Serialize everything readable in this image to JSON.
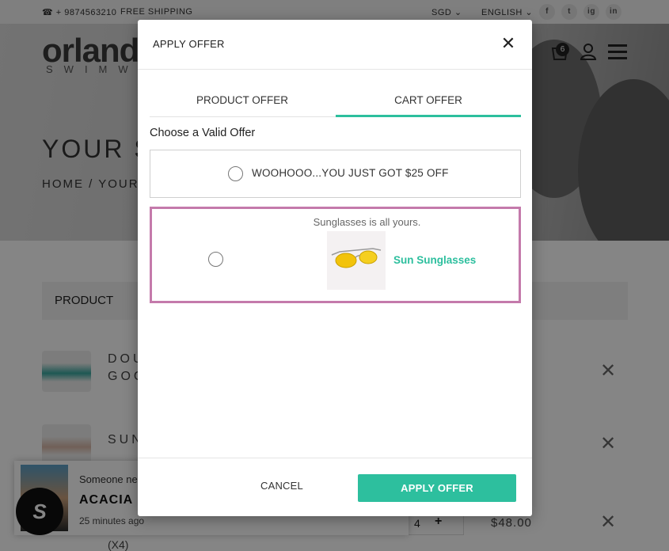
{
  "topbar": {
    "phone": "☎ + 9874563210",
    "shipping": "FREE SHIPPING",
    "currency": "SGD ⌄",
    "language": "ENGLISH ⌄",
    "social": [
      "f",
      "t",
      "ig",
      "in"
    ]
  },
  "header": {
    "logo": "orland",
    "logo_sub": "SWIMWEA",
    "cart_count": "6"
  },
  "hero": {
    "title": "YOUR SH",
    "breadcrumb": "HOME / YOUR SH"
  },
  "cart_table": {
    "header_product": "PRODUCT",
    "rows": [
      {
        "name_line1": "DOU",
        "name_line2": "GOG"
      },
      {
        "name_line1": "SUN",
        "name_line2": ""
      }
    ],
    "qty": "4",
    "qty_plus": "+",
    "price": "$48.00",
    "sub": "(X4)",
    "remove": "✕"
  },
  "notification": {
    "line1": "Someone ne",
    "line2": "ACACIA U",
    "line3": "25 minutes ago",
    "badge": "S"
  },
  "modal": {
    "title": "APPLY OFFER",
    "close": "✕",
    "tabs": [
      {
        "label": "PRODUCT OFFER",
        "active": false
      },
      {
        "label": "CART OFFER",
        "active": true
      }
    ],
    "choose_label": "Choose a Valid Offer",
    "offers": [
      {
        "label": "WOOHOOO...YOU JUST GOT $25 OFF"
      },
      {
        "subtitle": "Sunglasses is all yours.",
        "product_name": "Sun Sunglasses"
      }
    ],
    "cancel_label": "CANCEL",
    "apply_label": "APPLY OFFER",
    "accent_color": "#2dbf9e",
    "highlight_color": "#c47aab"
  }
}
